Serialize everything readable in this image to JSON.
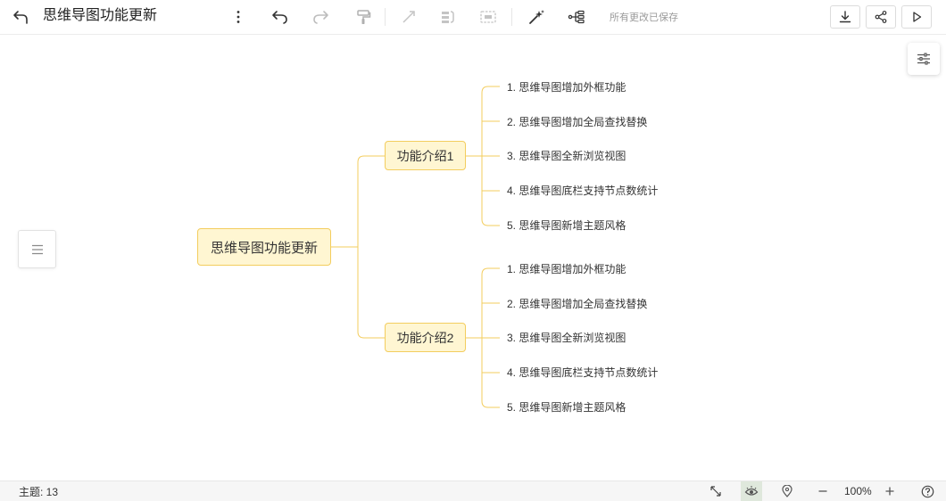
{
  "toolbar": {
    "title": "思维导图功能更新",
    "save_status": "所有更改已保存"
  },
  "mindmap": {
    "root": "思维导图功能更新",
    "branches": [
      {
        "label": "功能介绍1",
        "items": [
          "1. 思维导图增加外框功能",
          "2. 思维导图增加全局查找替换",
          "3. 思维导图全新浏览视图",
          "4. 思维导图底栏支持节点数统计",
          "5. 思维导图新增主题风格"
        ]
      },
      {
        "label": "功能介绍2",
        "items": [
          "1. 思维导图增加外框功能",
          "2. 思维导图增加全局查找替换",
          "3. 思维导图全新浏览视图",
          "4. 思维导图底栏支持节点数统计",
          "5. 思维导图新增主题风格"
        ]
      }
    ]
  },
  "statusbar": {
    "topic_count": "主题:  13",
    "zoom": "100%"
  },
  "colors": {
    "node_fill": "#fff6d2",
    "node_border": "#f3cd5e",
    "line": "#f3cd5e"
  }
}
